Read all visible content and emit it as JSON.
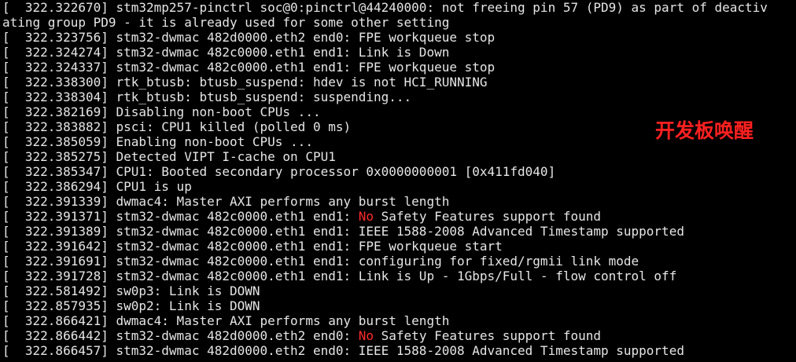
{
  "colors": {
    "background": "#000000",
    "text": "#e6e6e6",
    "highlight": "#ff2b2b",
    "annotation": "#ff2020"
  },
  "terminal": {
    "lines": [
      [
        {
          "text": "[  322.322670] stm32mp257-pinctrl soc@0:pinctrl@44240000: not freeing pin 57 (PD9) as part of deactiv"
        }
      ],
      [
        {
          "text": "ating group PD9 - it is already used for some other setting"
        }
      ],
      [
        {
          "text": "[  322.323756] stm32-dwmac 482d0000.eth2 end0: FPE workqueue stop"
        }
      ],
      [
        {
          "text": "[  322.324274] stm32-dwmac 482c0000.eth1 end1: Link is Down"
        }
      ],
      [
        {
          "text": "[  322.324337] stm32-dwmac 482c0000.eth1 end1: FPE workqueue stop"
        }
      ],
      [
        {
          "text": "[  322.338300] rtk_btusb: btusb_suspend: hdev is not HCI_RUNNING"
        }
      ],
      [
        {
          "text": "[  322.338304] rtk_btusb: btusb_suspend: suspending..."
        }
      ],
      [
        {
          "text": "[  322.382169] Disabling non-boot CPUs ..."
        }
      ],
      [
        {
          "text": "[  322.383882] psci: CPU1 killed (polled 0 ms)"
        }
      ],
      [
        {
          "text": "[  322.385059] Enabling non-boot CPUs ..."
        }
      ],
      [
        {
          "text": "[  322.385275] Detected VIPT I-cache on CPU1"
        }
      ],
      [
        {
          "text": "[  322.385347] CPU1: Booted secondary processor 0x0000000001 [0x411fd040]"
        }
      ],
      [
        {
          "text": "[  322.386294] CPU1 is up"
        }
      ],
      [
        {
          "text": "[  322.391339] dwmac4: Master AXI performs any burst length"
        }
      ],
      [
        {
          "text": "[  322.391371] stm32-dwmac 482c0000.eth1 end1: "
        },
        {
          "text": "No",
          "red": true
        },
        {
          "text": " Safety Features support found"
        }
      ],
      [
        {
          "text": "[  322.391389] stm32-dwmac 482c0000.eth1 end1: IEEE 1588-2008 Advanced Timestamp supported"
        }
      ],
      [
        {
          "text": "[  322.391642] stm32-dwmac 482c0000.eth1 end1: FPE workqueue start"
        }
      ],
      [
        {
          "text": "[  322.391691] stm32-dwmac 482c0000.eth1 end1: configuring for fixed/rgmii link mode"
        }
      ],
      [
        {
          "text": "[  322.391728] stm32-dwmac 482c0000.eth1 end1: Link is Up - 1Gbps/Full - flow control off"
        }
      ],
      [
        {
          "text": "[  322.581492] sw0p3: Link is DOWN"
        }
      ],
      [
        {
          "text": "[  322.857935] sw0p2: Link is DOWN"
        }
      ],
      [
        {
          "text": "[  322.866421] dwmac4: Master AXI performs any burst length"
        }
      ],
      [
        {
          "text": "[  322.866442] stm32-dwmac 482d0000.eth2 end0: "
        },
        {
          "text": "No",
          "red": true
        },
        {
          "text": " Safety Features support found"
        }
      ],
      [
        {
          "text": "[  322.866457] stm32-dwmac 482d0000.eth2 end0: IEEE 1588-2008 Advanced Timestamp supported"
        }
      ]
    ]
  },
  "annotation": {
    "text": "开发板唤醒"
  }
}
